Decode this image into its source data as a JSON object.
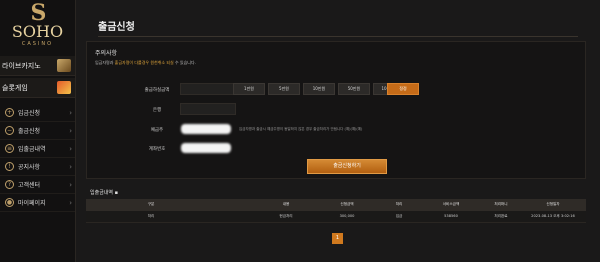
{
  "brand": {
    "logo_mark": "S",
    "name": "SOHO",
    "sub": "CASINO"
  },
  "sidebar": {
    "games": [
      {
        "label": "라이브카지노",
        "icon": "live-casino-thumb"
      },
      {
        "label": "슬롯게임",
        "icon": "slot-thumb"
      }
    ],
    "items": [
      {
        "label": "입금신청",
        "icon": "deposit-icon"
      },
      {
        "label": "출금신청",
        "icon": "withdraw-icon"
      },
      {
        "label": "입출금내역",
        "icon": "history-icon"
      },
      {
        "label": "공지사항",
        "icon": "notice-icon"
      },
      {
        "label": "고객센터",
        "icon": "support-icon"
      },
      {
        "label": "마이페이지",
        "icon": "user-icon"
      }
    ]
  },
  "page": {
    "title": "출금신청"
  },
  "notice": {
    "title": "주의사항",
    "text_pre": "입금자명과 ",
    "text_hl": "출금자명이 다를경우 원천취소 되실",
    "text_post": " 수 있습니다."
  },
  "form": {
    "amount_label": "출금하실금액",
    "amount_buttons": [
      "1만원",
      "5만원",
      "10만원",
      "50만원",
      "100만원"
    ],
    "reset_label": "정정",
    "bank_label": "은행",
    "holder_label": "예금주",
    "holder_help": "입금자명과 출금시 예금주명이 동일하지 않은 경우 출금처리가 안됩니다 (예)(예)(예)",
    "account_label": "계좌번호",
    "submit_label": "출금신청하기"
  },
  "history": {
    "title": "입출금내역 ▪",
    "columns": [
      "구분",
      "내용",
      "신청금액",
      "처리",
      "서비스금액",
      "처리머니",
      "신청일자"
    ],
    "rows": [
      [
        "처리",
        "현금처리",
        "300,000",
        "입금",
        "538560",
        "처리완료",
        "2023-08-13 오후 3:02:16"
      ]
    ]
  },
  "pagination": {
    "current": "1"
  },
  "colors": {
    "accent": "#d0791e",
    "gold": "#c9a86a",
    "bg": "#1a1919"
  }
}
